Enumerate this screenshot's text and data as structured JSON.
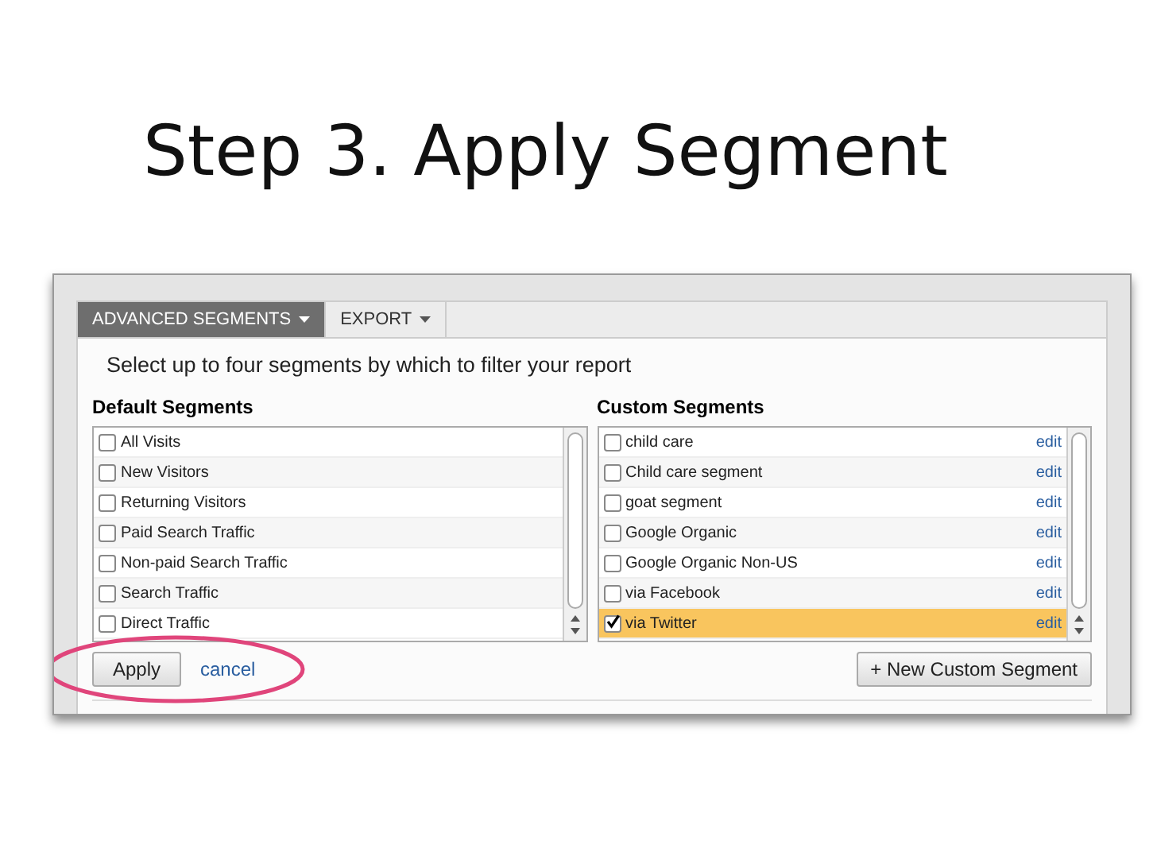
{
  "slide": {
    "title": "Step 3. Apply Segment"
  },
  "tabs": [
    {
      "label": "ADVANCED SEGMENTS",
      "selected": true
    },
    {
      "label": "EXPORT",
      "selected": false
    }
  ],
  "instruction": "Select up to four segments by which to filter your report",
  "default_segments": {
    "heading": "Default Segments",
    "items": [
      {
        "label": "All Visits",
        "checked": false
      },
      {
        "label": "New Visitors",
        "checked": false
      },
      {
        "label": "Returning Visitors",
        "checked": false
      },
      {
        "label": "Paid Search Traffic",
        "checked": false
      },
      {
        "label": "Non-paid Search Traffic",
        "checked": false
      },
      {
        "label": "Search Traffic",
        "checked": false
      },
      {
        "label": "Direct Traffic",
        "checked": false
      }
    ]
  },
  "custom_segments": {
    "heading": "Custom Segments",
    "items": [
      {
        "label": "child care",
        "checked": false,
        "action": "edit"
      },
      {
        "label": "Child care segment",
        "checked": false,
        "action": "edit"
      },
      {
        "label": "goat segment",
        "checked": false,
        "action": "edit"
      },
      {
        "label": "Google Organic",
        "checked": false,
        "action": "edit"
      },
      {
        "label": "Google Organic Non-US",
        "checked": false,
        "action": "edit"
      },
      {
        "label": "via Facebook",
        "checked": false,
        "action": "edit"
      },
      {
        "label": "via Twitter",
        "checked": true,
        "action": "edit"
      }
    ]
  },
  "apply_button": "Apply",
  "cancel_link": "cancel",
  "new_segment_button": "+ New Custom Segment"
}
